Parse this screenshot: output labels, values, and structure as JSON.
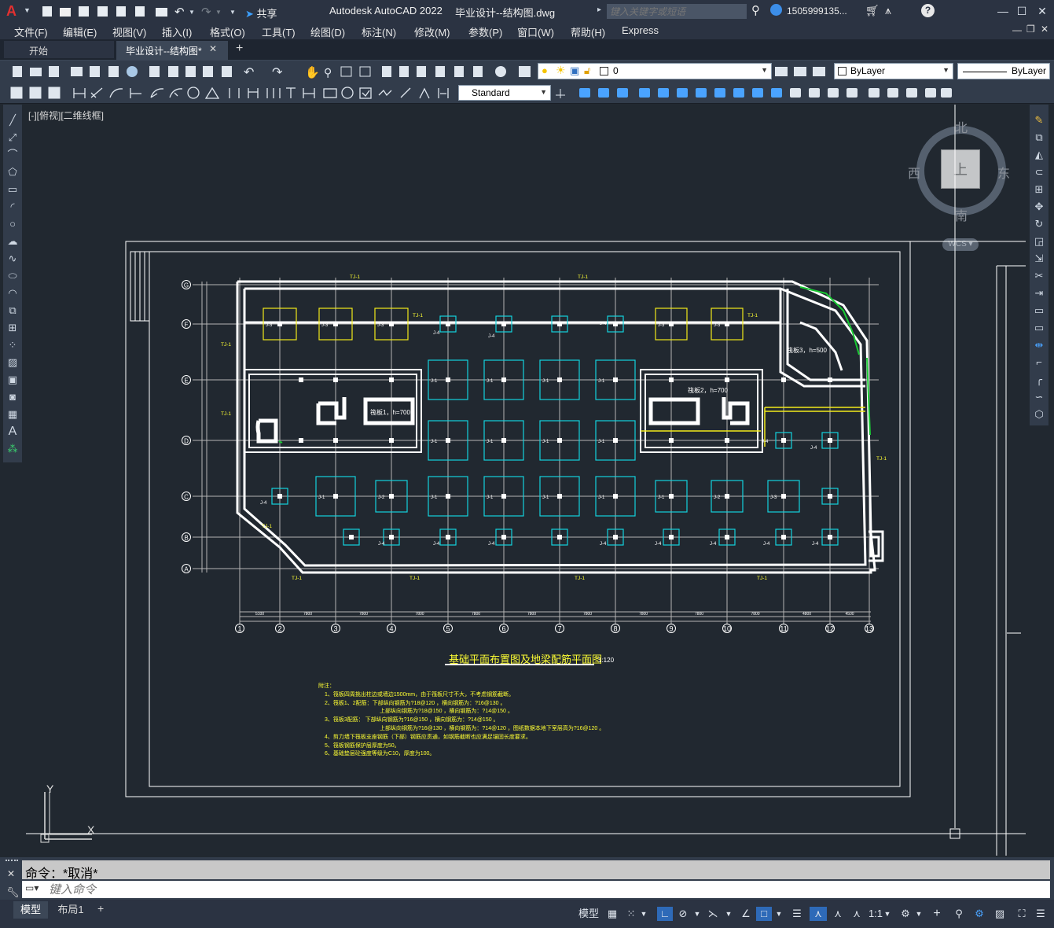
{
  "titlebar": {
    "app_logo": "A",
    "app_title": "Autodesk AutoCAD 2022",
    "file_title": "毕业设计--结构图.dwg",
    "share_label": "共享",
    "search_placeholder": "键入关键字或短语",
    "user_name": "1505999135...",
    "icons": [
      "new-icon",
      "open-icon",
      "save-icon",
      "saveas-icon",
      "publish-icon",
      "plot-icon",
      "undo-icon",
      "redo-icon",
      "share-icon",
      "search-icon",
      "user-icon",
      "cart-icon",
      "autodesk-app-icon",
      "help-icon"
    ]
  },
  "menubar": {
    "items": [
      "文件(F)",
      "编辑(E)",
      "视图(V)",
      "插入(I)",
      "格式(O)",
      "工具(T)",
      "绘图(D)",
      "标注(N)",
      "修改(M)",
      "参数(P)",
      "窗口(W)",
      "帮助(H)",
      "Express"
    ]
  },
  "tabs": {
    "start_label": "开始",
    "active_label": "毕业设计--结构图*",
    "add_label": "+"
  },
  "toolbar": {
    "layer_value": "0",
    "color_value": "ByLayer",
    "linetype_value": "ByLayer",
    "textstyle_value": "Standard"
  },
  "viewport": {
    "label": "[-][俯视][二维线框]",
    "viewcube": {
      "north": "北",
      "south": "南",
      "east": "东",
      "west": "西",
      "top": "上",
      "wcs": "WCS"
    },
    "ucs": {
      "x_label": "X",
      "y_label": "Y"
    }
  },
  "drawing": {
    "title": "基础平面布置图及地梁配筋平面图",
    "scale": "1:120",
    "notes_header": "附注：",
    "notes": [
      "1、筏板四周挑出柱边或墙边1500mm，由于筏板尺寸不大，不考虑钢筋截断。",
      "2、筏板1、2配筋：下部纵向钢筋为?18@120 ，横向钢筋为：?16@130 。",
      "上部纵向钢筋为?18@150 ，横向钢筋为：?14@150 。",
      "3、筏板3配筋：  下部纵向钢筋为?16@150 ，横向钢筋为：?14@150 。",
      "上部纵向钢筋为?16@130 ，横向钢筋为：?14@120 ，图纸数据本地下室层高为?16@120 。",
      "4、剪力墙下筏板支座钢筋（下部）钢筋应贯通，如钢筋截断也应满足锚固长度要求。",
      "5、筏板钢筋保护层厚度为50。",
      "6、基础垫层砼强度等级为C10，厚度为100。"
    ],
    "axes_x": [
      "1",
      "2",
      "3",
      "4",
      "5",
      "6",
      "7",
      "8",
      "9",
      "10",
      "11",
      "12",
      "13"
    ],
    "axes_y": [
      "G",
      "F",
      "E",
      "D",
      "C",
      "B",
      "A"
    ],
    "raft_labels": {
      "raft1": "筏板1，h=700",
      "raft2": "筏板2，h=700",
      "raft3": "筏板3，h=500"
    },
    "beam_label": "TJ-1",
    "footing_labels": [
      "J-1",
      "J-2",
      "J-3",
      "J-4"
    ],
    "dim_texts": [
      "5100",
      "7800",
      "7800",
      "7800",
      "7800",
      "7800",
      "7800",
      "7800",
      "7800",
      "7800",
      "4800",
      "4500",
      "4500"
    ],
    "colors": {
      "outline": "#ffffff",
      "grid": "#b8b8b8",
      "footing_cyan": "#13d3dd",
      "footing_yellow": "#f2ea1a",
      "text_yellow": "#ffff33",
      "green": "#18c932"
    }
  },
  "command": {
    "history": "命令：*取消*",
    "placeholder": "键入命令"
  },
  "status": {
    "layout_tabs": [
      "模型",
      "布局1"
    ],
    "add": "+",
    "model_label": "模型",
    "scale": "1:1"
  }
}
